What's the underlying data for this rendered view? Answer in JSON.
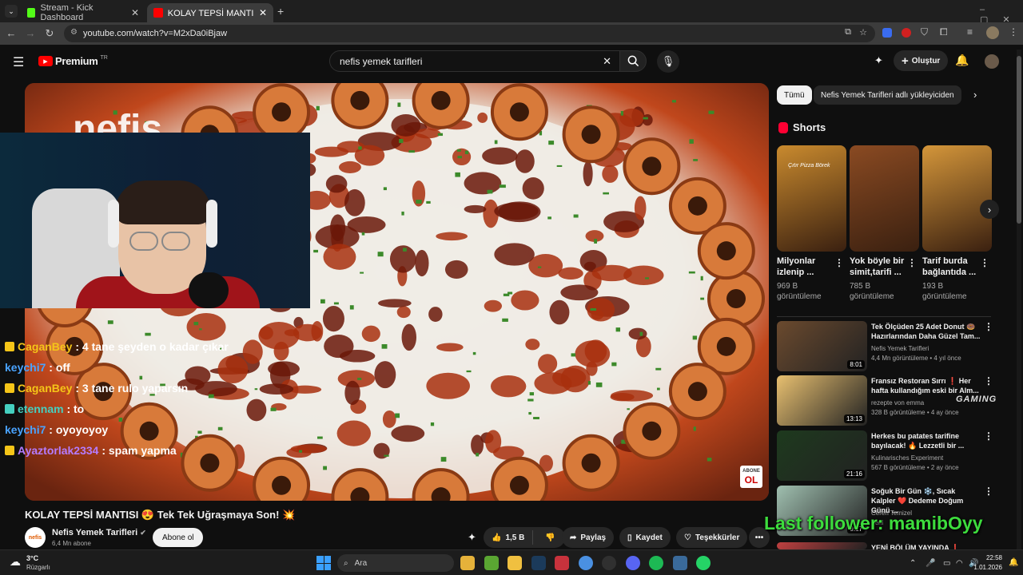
{
  "browser": {
    "tabs": [
      {
        "label": "Stream - Kick Dashboard",
        "favicon_color": "#53fc18"
      },
      {
        "label": "KOLAY TEPSİ MANTISI 😍 Tek T",
        "favicon_color": "#ff0000"
      }
    ],
    "new_tab": "+",
    "url": "youtube.com/watch?v=M2xDa0iBjaw"
  },
  "youtube": {
    "logo_text": "Premium",
    "logo_badge": "TR",
    "search_value": "nefis yemek tarifleri",
    "create_label": "Oluştur",
    "video_title": "KOLAY TEPSİ MANTISI 😍 Tek Tek Uğraşmaya Son! 💥",
    "channel_name": "Nefis Yemek Tarifleri",
    "channel_avatar_text": "nefis",
    "subscribers": "6,4 Mn abone",
    "subscribe_label": "Abone ol",
    "likes": "1,5 B",
    "share_label": "Paylaş",
    "save_label": "Kaydet",
    "thanks_label": "Teşekkürler",
    "abone_badge_top": "ABONE",
    "abone_badge_bottom": "OL",
    "watermark_text": "nefis"
  },
  "chat_overlay": [
    {
      "user": "CaganBey",
      "text": " : 4 tane şeyden o kadar çıkar",
      "color": "#f5c518",
      "badge": "crown"
    },
    {
      "user": "keychi7",
      "text": " : off",
      "color": "#4aa3ff",
      "badge": ""
    },
    {
      "user": "CaganBey",
      "text": " : 3 tane rulo yaparsın",
      "color": "#f5c518",
      "badge": "crown"
    },
    {
      "user": "etennam",
      "text": " : to",
      "color": "#45d0c0",
      "badge": "multi"
    },
    {
      "user": "keychi7",
      "text": " : oyoyoyoy",
      "color": "#4aa3ff",
      "badge": ""
    },
    {
      "user": "Ayaztorlak2334",
      "text": " : spam yapma",
      "color": "#b57cff",
      "badge": "crown"
    }
  ],
  "sidebar": {
    "chips": [
      "Tümü",
      "Nefis Yemek Tarifleri adlı yükleyiciden"
    ],
    "shorts_heading": "Shorts",
    "shorts": [
      {
        "title": "Milyonlar izlenip ...",
        "views": "969 B görüntüleme",
        "thumb_text": "Çıtır Pizza Börek",
        "color": "#c98a2e"
      },
      {
        "title": "Yok böyle bir simit,tarifi ...",
        "views": "785 B görüntüleme",
        "thumb_text": "",
        "color": "#8a4a22"
      },
      {
        "title": "Tarif burda bağlantıda ...",
        "views": "193 B görüntüleme",
        "thumb_text": "",
        "color": "#d4963a"
      }
    ],
    "recommendations": [
      {
        "title": "Tek Ölçüden 25 Adet Donut 🍩 Hazırlarından Daha Güzel Tam...",
        "channel": "Nefis Yemek Tarifleri",
        "meta": "4,4 Mn görüntüleme • 4 yıl önce",
        "duration": "8:01",
        "color": "#6b4a2e"
      },
      {
        "title": "Fransız Restoran Sırrı ❗ Her hafta kullandığım eski bir Alm...",
        "channel": "rezepte von emma",
        "meta": "328 B görüntüleme • 4 ay önce",
        "duration": "13:13",
        "color": "#e8c070"
      },
      {
        "title": "Herkes bu patates tarifine bayılacak! 🔥 Lezzetli bir ...",
        "channel": "Kulinarisches Experiment",
        "meta": "567 B görüntüleme • 2 ay önce",
        "duration": "21:16",
        "color": "#1e3a1e"
      },
      {
        "title": "Soğuk Bir Gün ❄️, Sıcak Kalpler ❤️ Dedeme Doğum Günü ...",
        "channel": "Ceren Temizel",
        "meta": "Yeni",
        "duration": "9:17",
        "color": "#a0c0b0"
      },
      {
        "title": "YENİ BÖLÜM YAYINDA ❗",
        "channel": "",
        "meta": "",
        "duration": "",
        "color": "#c04040"
      }
    ]
  },
  "stream_overlay": {
    "last_follower": "Last follower: mamibOyy",
    "gaming_logo": "GAMING"
  },
  "taskbar": {
    "weather_temp": "3°C",
    "weather_desc": "Rüzgarlı",
    "search_placeholder": "Ara",
    "time": "22:58",
    "date": "1.01.2026"
  },
  "colors": {
    "yt_red": "#ff0000",
    "accent_blue": "#3ea6ff",
    "follower_green": "#3ddc3d"
  }
}
